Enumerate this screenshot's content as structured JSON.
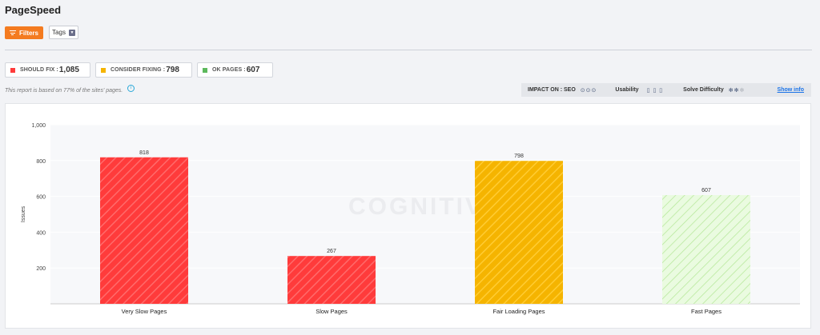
{
  "page": {
    "title": "PageSpeed"
  },
  "toolbar": {
    "filters_label": "Filters",
    "tags_label": "Tags"
  },
  "stats": [
    {
      "label": "SHOULD FIX : ",
      "value": "1,085",
      "color": "#ff3b3b"
    },
    {
      "label": "CONSIDER FIXING : ",
      "value": "798",
      "color": "#f5b400"
    },
    {
      "label": "OK PAGES : ",
      "value": "607",
      "color": "#5cb85c"
    }
  ],
  "note": "This report is based on 77% of the sites' pages.",
  "impact": {
    "seo_label": "IMPACT ON : SEO",
    "usability_label": "Usability",
    "solve_label": "Solve Difficulty",
    "show_info": "Show info",
    "seo_icon": "eye-icon",
    "usability_icon": "user-icon",
    "solve_icon": "gear-icon"
  },
  "chart_data": {
    "type": "bar",
    "categories": [
      "Very Slow Pages",
      "Slow Pages",
      "Fair Loading Pages",
      "Fast Pages"
    ],
    "values": [
      818,
      267,
      798,
      607
    ],
    "colors": [
      "#ff3b3b",
      "#ff3b3b",
      "#f5b400",
      "#d8f5c2"
    ],
    "ylabel": "Issues",
    "ylim": [
      0,
      1000
    ],
    "yticks": [
      200,
      400,
      600,
      800,
      1000
    ],
    "ytick_labels": [
      "200",
      "400",
      "600",
      "800",
      "1,000"
    ],
    "watermark": "COGNITIVE",
    "grid": true
  }
}
